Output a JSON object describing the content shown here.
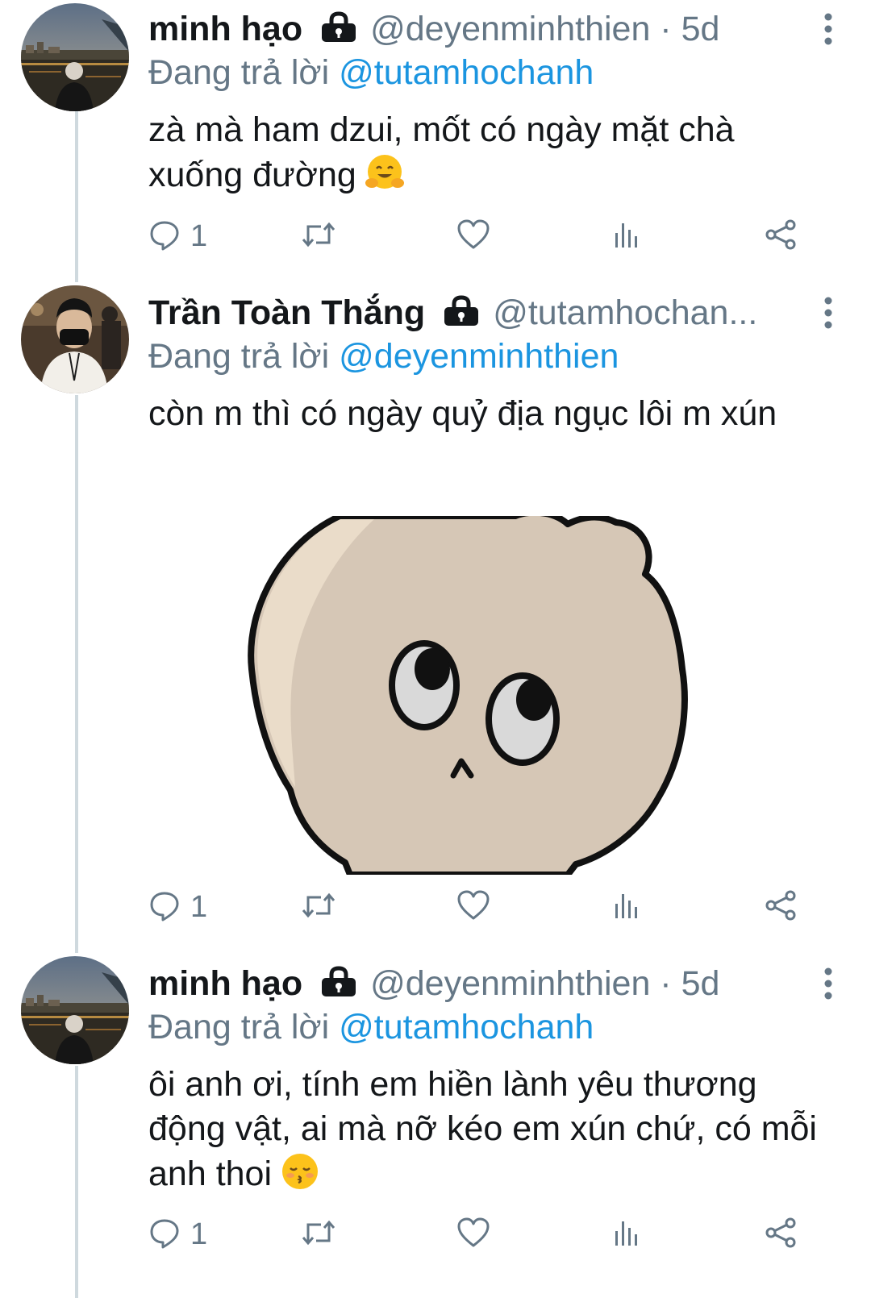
{
  "tweets": [
    {
      "name": "minh hạo",
      "handle": "@deyenminhthien · 5d",
      "replying_prefix": "Đang trả lời",
      "replying_to": "@tutamhochanh",
      "text": "zà mà ham dzui, mốt có ngày mặt chà xuống đường",
      "emoji": "hugging-face",
      "reply_count": "1"
    },
    {
      "name": "Trần Toàn Thắng",
      "handle": "@tutamhochan...",
      "replying_prefix": "Đang trả lời",
      "replying_to": "@deyenminhthien",
      "text": "còn m thì có ngày quỷ địa ngục lôi m xún",
      "media": "cartoon-skull-sticker",
      "reply_count": "1"
    },
    {
      "name": "minh hạo",
      "handle": "@deyenminhthien · 5d",
      "replying_prefix": "Đang trả lời",
      "replying_to": "@tutamhochanh",
      "text": "ôi anh ơi, tính em hiền lành yêu thương động vật, ai mà nỡ kéo em xún chứ, có mỗi anh thoi",
      "emoji": "kissing-face-with-closed-eyes",
      "reply_count": "1"
    }
  ],
  "colors": {
    "name": "#14171a",
    "secondary": "#657786",
    "mention": "#1b95e0",
    "thread_line": "#cfd9de"
  }
}
